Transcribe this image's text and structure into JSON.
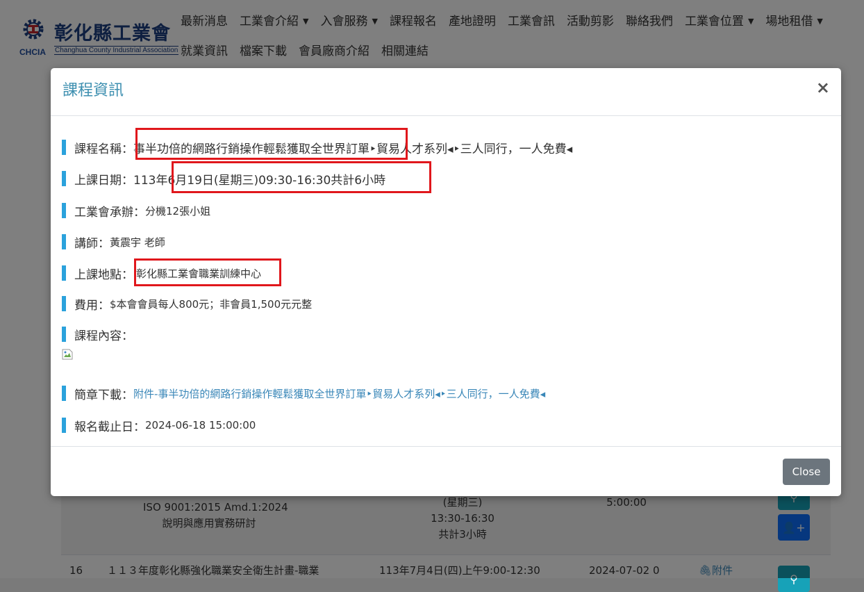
{
  "site": {
    "name": "彰化縣工業會",
    "english_name": "Changhua County Industrial Association",
    "abbr": "CHCIA"
  },
  "nav": {
    "row1": [
      {
        "label": "最新消息",
        "dropdown": false
      },
      {
        "label": "工業會介紹",
        "dropdown": true
      },
      {
        "label": "入會服務",
        "dropdown": true
      },
      {
        "label": "課程報名",
        "dropdown": false
      },
      {
        "label": "產地證明",
        "dropdown": false
      },
      {
        "label": "工業會訊",
        "dropdown": false
      },
      {
        "label": "活動剪影",
        "dropdown": false
      },
      {
        "label": "聯絡我們",
        "dropdown": false
      },
      {
        "label": "工業會位置",
        "dropdown": true
      },
      {
        "label": "場地租借",
        "dropdown": true
      }
    ],
    "row2": [
      {
        "label": "就業資訊"
      },
      {
        "label": "檔案下載"
      },
      {
        "label": "會員廠商介紹"
      },
      {
        "label": "相關連結"
      }
    ]
  },
  "background_table": {
    "row_a": {
      "course": [
        "ISO 9001:2015 Amd.1:2024",
        "說明與應用實務研討"
      ],
      "date": [
        "(星期三)",
        "13:30-16:30",
        "共計3小時"
      ],
      "deadline": "5:00:00"
    },
    "row_b": {
      "no": "16",
      "course": "１１３年度彰化縣強化職業安全衛生計畫-職業",
      "date": "113年7月4日(四)上午9:00-12:30",
      "deadline": "2024-07-02 0",
      "attachment": "附件"
    }
  },
  "modal": {
    "title": "課程資訊",
    "close_x": "×",
    "fields": {
      "name_label": "課程名稱：",
      "name_value": "事半功倍的網路行銷操作輕鬆獲取全世界訂單‣貿易人才系列◂‣三人同行，一人免費◂",
      "date_label": "上課日期：",
      "date_value": "113年6月19日(星期三)09:30-16:30共計6小時",
      "organizer_label": "工業會承辦：",
      "organizer_value": "分機12張小姐",
      "instructor_label": "講師：",
      "instructor_value": "黃震宇 老師",
      "location_label": "上課地點：",
      "location_value": "彰化縣工業會職業訓練中心",
      "fee_label": "費用：",
      "fee_value": "$本會會員每人800元；非會員1,500元元整",
      "content_label": "課程內容：",
      "brochure_label": "簡章下載：",
      "brochure_link": "附件-事半功倍的網路行銷操作輕鬆獲取全世界訂單‣貿易人才系列◂‣三人同行，一人免費◂",
      "deadline_label": "報名截止日：",
      "deadline_value": "2024-06-18 15:00:00"
    },
    "close_button": "Close"
  },
  "colors": {
    "accent_bar": "#2ba2dc",
    "title": "#3d8fb0",
    "highlight_box": "#e0171c",
    "link": "#3a87b8",
    "close_button": "#6c757d",
    "teal_button": "#17a2b8",
    "blue_button": "#0d6efd"
  },
  "icons": [
    "gear-logo-icon",
    "caret-down-icon",
    "search-icon",
    "user-plus-icon",
    "paperclip-icon",
    "broken-image-icon",
    "close-icon"
  ]
}
